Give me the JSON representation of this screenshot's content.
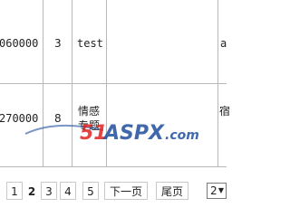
{
  "table": {
    "rows": [
      {
        "id": "060000",
        "num": "3",
        "title": "test",
        "extra": "a"
      },
      {
        "id": "270000",
        "num": "8",
        "title_line1": "情感",
        "title_line2": "专题",
        "extra": "宿"
      }
    ]
  },
  "watermark": {
    "brand": "51ASPX",
    "suffix": ".com",
    "colors": {
      "number": "#e32323",
      "text": "#1f4e9c"
    }
  },
  "pagination": {
    "pages": [
      {
        "label": "1",
        "current": false
      },
      {
        "label": "2",
        "current": true
      },
      {
        "label": "3",
        "current": false
      },
      {
        "label": "4",
        "current": false
      },
      {
        "label": "5",
        "current": false
      }
    ],
    "next_label": "下一页",
    "last_label": "尾页",
    "page_select": "2"
  }
}
